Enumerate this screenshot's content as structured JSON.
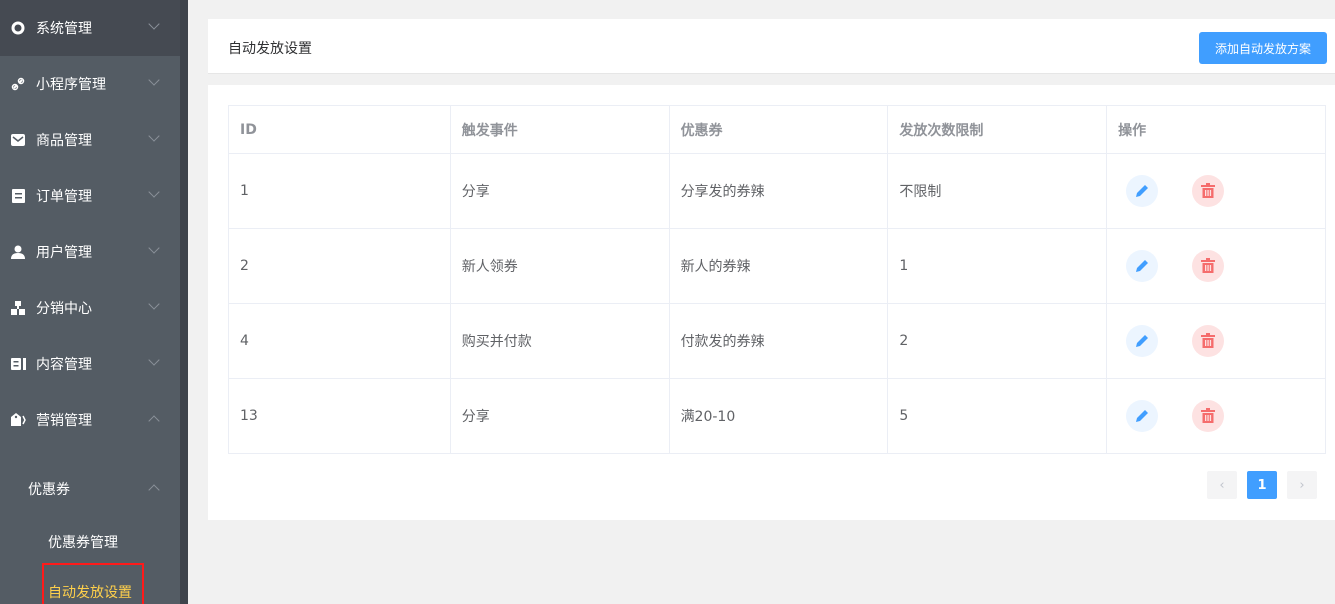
{
  "sidebar": {
    "items": [
      {
        "label": "系统管理",
        "icon": "gear-icon"
      },
      {
        "label": "小程序管理",
        "icon": "link-icon"
      },
      {
        "label": "商品管理",
        "icon": "mail-icon"
      },
      {
        "label": "订单管理",
        "icon": "clipboard-icon"
      },
      {
        "label": "用户管理",
        "icon": "user-icon"
      },
      {
        "label": "分销中心",
        "icon": "org-chart-icon"
      },
      {
        "label": "内容管理",
        "icon": "content-icon"
      },
      {
        "label": "营销管理",
        "icon": "tag-icon"
      }
    ],
    "submenu": {
      "label": "优惠券",
      "items": [
        "优惠券管理",
        "自动发放设置"
      ]
    }
  },
  "header": {
    "title": "自动发放设置",
    "add_label": "添加自动发放方案"
  },
  "table": {
    "columns": [
      "ID",
      "触发事件",
      "优惠券",
      "发放次数限制",
      "操作"
    ],
    "rows": [
      [
        "1",
        "分享",
        "分享发的券辣",
        "不限制"
      ],
      [
        "2",
        "新人领券",
        "新人的券辣",
        "1"
      ],
      [
        "4",
        "购买并付款",
        "付款发的券辣",
        "2"
      ],
      [
        "13",
        "分享",
        "满20-10",
        "5"
      ]
    ]
  },
  "pagination": {
    "current": "1",
    "prev": "‹",
    "next": "›"
  },
  "colors": {
    "accent": "#409eff",
    "active": "#ffd04b",
    "danger": "#f56c6c"
  }
}
